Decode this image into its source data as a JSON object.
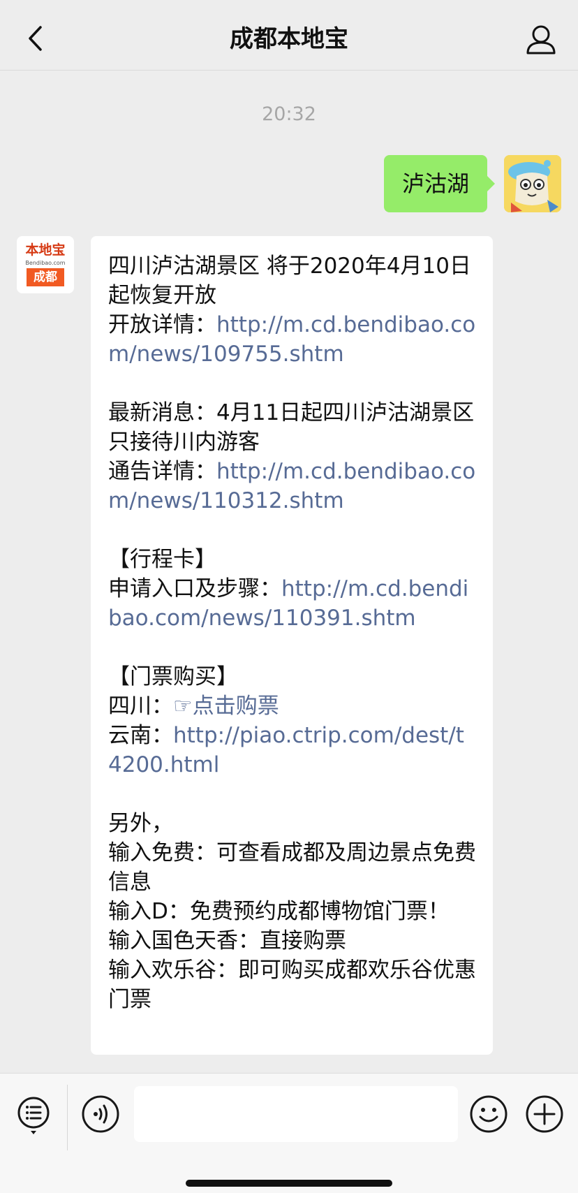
{
  "header": {
    "title": "成都本地宝",
    "back_icon": "chevron-left-icon",
    "profile_icon": "person-icon"
  },
  "chat": {
    "timestamp": "20:32",
    "outgoing": {
      "text": "泸沽湖"
    },
    "bot_avatar": {
      "logo_top": "本地宝",
      "logo_mid": "Bendibao.com",
      "logo_bottom": "成都"
    },
    "incoming": {
      "p1_l1": "四川泸沽湖景区 将于2020年4月10日起恢复开放",
      "p1_l2_label": "开放详情：",
      "p1_l2_link": "http://m.cd.bendibao.com/news/109755.shtm",
      "p2_l1": "最新消息：4月11日起四川泸沽湖景区只接待川内游客",
      "p2_l2_label": "通告详情：",
      "p2_l2_link": "http://m.cd.bendibao.com/news/110312.shtm",
      "p3_l1": "【行程卡】",
      "p3_l2_label": "申请入口及步骤：",
      "p3_l2_link": "http://m.cd.bendibao.com/news/110391.shtm",
      "p4_l1": "【门票购买】",
      "p4_l2_label": "四川：",
      "p4_l2_link": "☞点击购票",
      "p4_l3_label": "云南：",
      "p4_l3_link": "http://piao.ctrip.com/dest/t4200.html",
      "p5_l1": "另外，",
      "p5_l2": "输入免费：可查看成都及周边景点免费信息",
      "p5_l3": "输入D：免费预约成都博物馆门票！",
      "p5_l4": "输入国色天香：直接购票",
      "p5_l5": "输入欢乐谷：即可购买成都欢乐谷优惠门票"
    }
  },
  "inputbar": {
    "menu_icon": "menu-list-icon",
    "voice_icon": "voice-icon",
    "emoji_icon": "emoji-icon",
    "plus_icon": "plus-icon",
    "input_value": ""
  },
  "colors": {
    "background": "#ededed",
    "outgoing_bubble": "#95ec69",
    "incoming_bubble": "#ffffff",
    "link": "#576b95",
    "timestamp": "#a6a6a6",
    "brand_orange": "#f15a22"
  }
}
